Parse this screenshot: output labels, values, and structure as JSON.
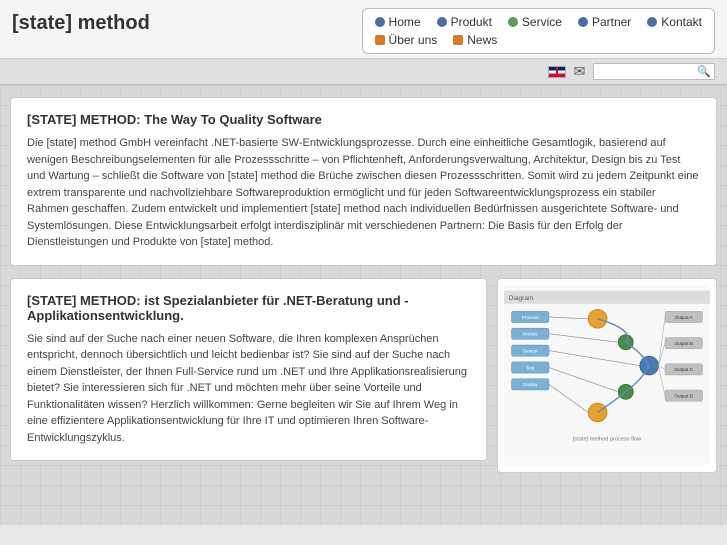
{
  "site": {
    "title": "[state] method"
  },
  "nav": {
    "row1": [
      {
        "label": "Home",
        "dot": "blue"
      },
      {
        "label": "Produkt",
        "dot": "blue"
      },
      {
        "label": "Service",
        "dot": "green"
      },
      {
        "label": "Partner",
        "dot": "blue"
      },
      {
        "label": "Kontakt",
        "dot": "blue"
      }
    ],
    "row2": [
      {
        "label": "Über uns",
        "dot": "orange"
      },
      {
        "label": "News",
        "dot": "orange"
      }
    ]
  },
  "search": {
    "placeholder": ""
  },
  "main_card": {
    "heading": "[STATE] METHOD: The Way To Quality Software",
    "body": "Die [state] method GmbH vereinfacht .NET-basierte SW-Entwicklungsprozesse. Durch eine einheitliche Gesamtlogik, basierend auf wenigen Beschreibungselementen für alle Prozessschritte – von Pflichtenheft, Anforderungsverwaltung, Architektur, Design bis zu Test und Wartung – schließt die Software von [state] method die Brüche zwischen diesen Prozessschritten. Somit wird zu jedem Zeitpunkt eine extrem transparente und nachvollziehbare Softwareproduktion ermöglicht und für jeden Softwareentwicklungsprozess ein stabiler Rahmen geschaffen. Zudem entwickelt und implementiert [state] method nach individuellen Bedürfnissen ausgerichtete Software- und Systemlösungen. Diese Entwicklungsarbeit erfolgt interdisziplinär mit verschiedenen Partnern: Die Basis für den Erfolg der Dienstleistungen und Produkte von [state] method."
  },
  "bottom_left_card": {
    "heading": "[STATE] METHOD: ist Spezialanbieter für .NET-Beratung und - Applikationsentwicklung.",
    "body": "Sie sind auf der Suche nach einer neuen Software, die Ihren komplexen Ansprüchen entspricht, dennoch übersichtlich und leicht bedienbar ist? Sie sind auf der Suche nach einem Dienstleister, der Ihnen Full-Service rund um .NET und Ihre Applikationsrealisierung bietet? Sie interessieren sich für .NET und möchten mehr über seine Vorteile und Funktionalitäten wissen? Herzlich willkommen: Gerne begleiten wir Sie auf Ihrem Weg in eine effizientere Applikationsentwicklung für Ihre IT und optimieren Ihren Software-Entwicklungszyklus."
  }
}
